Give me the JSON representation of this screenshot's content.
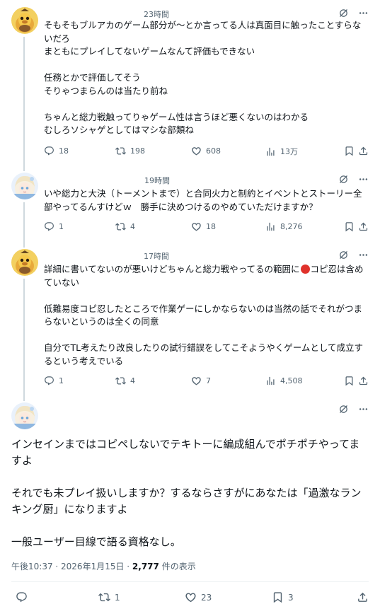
{
  "posts": [
    {
      "time": "23時間",
      "text": "そもそもブルアカのゲーム部分が～とか言ってる人は真面目に触ったことすらないだろ\nまともにプレイしてないゲームなんて評価もできない\n\n任務とかで評価してそう\nそりゃつまらんのは当たり前ね\n\nちゃんと総力戦触ってりゃゲーム性は言うほど悪くないのはわかる\nむしろソシャゲとしてはマシな部類ね",
      "replies": "18",
      "reposts": "198",
      "likes": "608",
      "views": "13万"
    },
    {
      "time": "19時間",
      "text": "いや総力と大決（トーメントまで）と合同火力と制約とイベントとストーリー全部やってるんすけどｗ　勝手に決めつけるのやめていただけますか？",
      "replies": "1",
      "reposts": "4",
      "likes": "18",
      "views": "8,276"
    },
    {
      "time": "17時間",
      "text_before_emoji": "詳細に書いてないのが悪いけどちゃんと総力戦やってるの範囲に",
      "text_after_emoji": "コピ忍は含めていない\n\n低難易度コピ忍したところで作業ゲーにしかならないのは当然の話でそれがつまらないというのは全くの同意\n\n自分でTL考えたり改良したりの試行錯誤をしてこそようやくゲームとして成立するという考えでいる",
      "replies": "1",
      "reposts": "4",
      "likes": "7",
      "views": "4,508"
    }
  ],
  "main_post": {
    "text": "インセインまではコピペしないでテキトーに編成組んでポチポチやってますよ\n\nそれでも未プレイ扱いしますか？するならさすがにあなたは「過激なランキング厨」になりますよ\n\n一般ユーザー目線で語る資格なし。",
    "timestamp": "午後10:37 · 2026年1月15日 · ",
    "view_count": "2,777",
    "view_suffix": " 件の表示",
    "reposts": "1",
    "likes": "23",
    "bookmarks": "3"
  },
  "icons": {
    "grok": "grok-icon",
    "more": "more-icon",
    "reply": "reply-icon",
    "repost": "repost-icon",
    "like": "like-icon",
    "views": "views-icon",
    "bookmark": "bookmark-icon",
    "share": "share-icon"
  },
  "colors": {
    "text": "#0f1419",
    "secondary": "#536471",
    "thread_line": "#cfd9de",
    "divider": "#eff3f4",
    "duck_avatar": "#f0c64a",
    "emoji_red": "#e0322b"
  }
}
